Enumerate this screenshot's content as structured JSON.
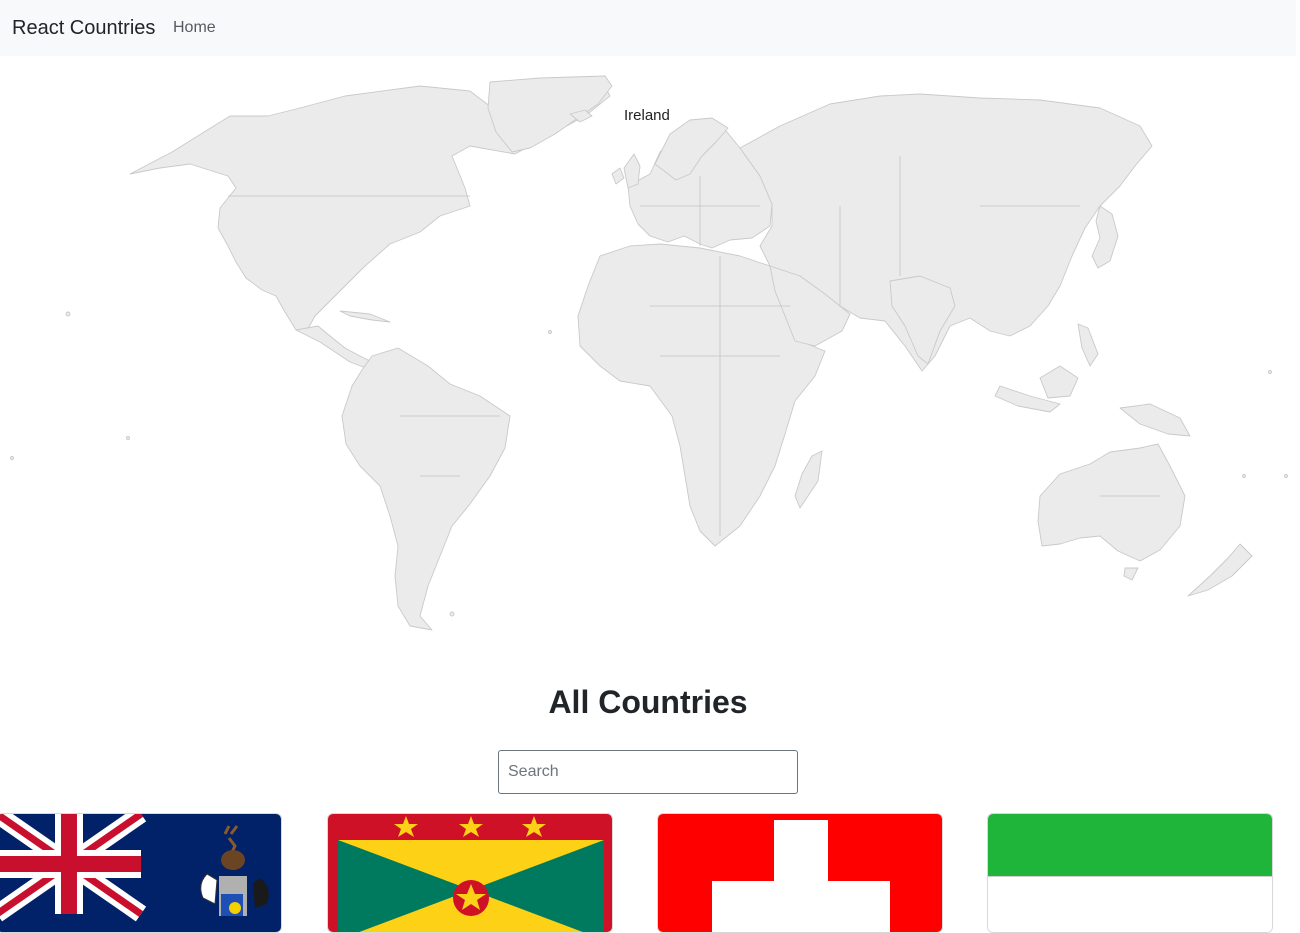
{
  "navbar": {
    "brand": "React Countries",
    "links": [
      {
        "label": "Home"
      }
    ]
  },
  "map": {
    "hovered_country": "Ireland",
    "land_color": "#ebebeb",
    "border_color": "#c9c9c9"
  },
  "main": {
    "heading": "All Countries",
    "search": {
      "placeholder": "Search",
      "value": ""
    }
  },
  "country_cards": [
    {
      "flag": "south-georgia-flag"
    },
    {
      "flag": "grenada-flag"
    },
    {
      "flag": "switzerland-flag"
    },
    {
      "flag": "sierra-leone-flag"
    }
  ]
}
